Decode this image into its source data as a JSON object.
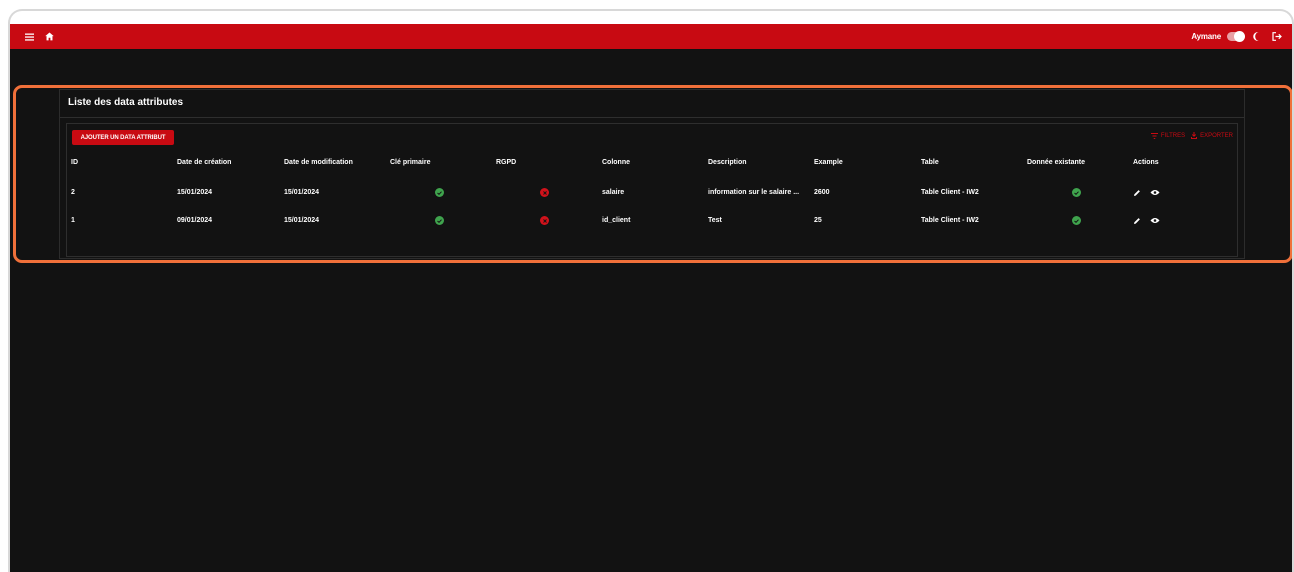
{
  "topbar": {
    "menu_icon": "menu-icon",
    "home_icon": "home-icon",
    "username": "Aymane",
    "theme_toggle_on": true,
    "moon_icon": "moon-icon",
    "logout_icon": "logout-icon"
  },
  "card": {
    "title": "Liste des data attributes"
  },
  "toolbar": {
    "add_label": "AJOUTER UN DATA ATTRIBUT",
    "filter_label": "FILTRES",
    "export_label": "EXPORTER"
  },
  "table": {
    "headers": {
      "id": "ID",
      "created": "Date de création",
      "modified": "Date de modification",
      "pk": "Clé primaire",
      "rgpd": "RGPD",
      "column": "Colonne",
      "description": "Description",
      "example": "Example",
      "table": "Table",
      "existing": "Donnée existante",
      "actions": "Actions"
    },
    "rows": [
      {
        "id": "2",
        "created": "15/01/2024",
        "modified": "15/01/2024",
        "pk": true,
        "rgpd": false,
        "column": "salaire",
        "description": "information sur le salaire ...",
        "example": "2600",
        "table": "Table Client - IW2",
        "existing": true
      },
      {
        "id": "1",
        "created": "09/01/2024",
        "modified": "15/01/2024",
        "pk": true,
        "rgpd": false,
        "column": "id_client",
        "description": "Test",
        "example": "25",
        "table": "Table Client - IW2",
        "existing": true
      }
    ]
  },
  "colors": {
    "accent": "#c80a12",
    "background": "#121212",
    "ok": "#3fa34d",
    "highlight": "#f0703a"
  }
}
